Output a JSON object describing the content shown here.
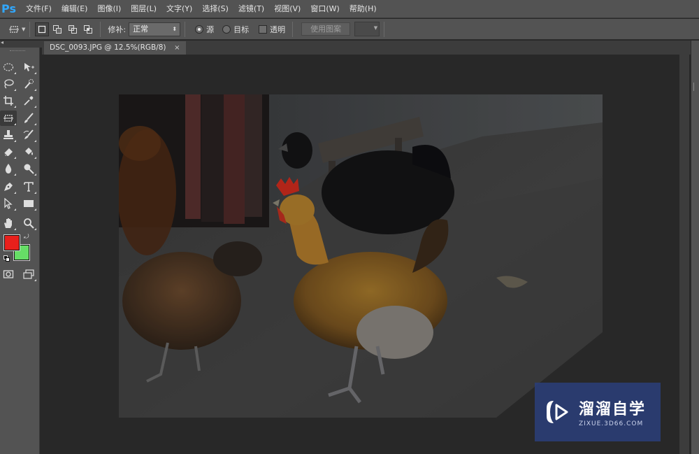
{
  "app": {
    "logo": "Ps"
  },
  "menu": [
    "文件(F)",
    "编辑(E)",
    "图像(I)",
    "图层(L)",
    "文字(Y)",
    "选择(S)",
    "滤镜(T)",
    "视图(V)",
    "窗口(W)",
    "帮助(H)"
  ],
  "options": {
    "tool_icon": "patch-tool-icon",
    "patch_label": "修补:",
    "patch_value": "正常",
    "source_label": "源",
    "target_label": "目标",
    "transparent_label": "透明",
    "use_pattern_label": "使用图案",
    "source_selected": true,
    "target_selected": false,
    "transparent_checked": false
  },
  "document": {
    "tab_title": "DSC_0093.JPG @ 12.5%(RGB/8)",
    "close_glyph": "×"
  },
  "colors": {
    "foreground": "#e8201c",
    "background": "#66dd66",
    "accent": "#31a8ff"
  },
  "tools": [
    "marquee-icon",
    "move-icon",
    "lasso-icon",
    "quick-selection-icon",
    "crop-icon",
    "eyedropper-icon",
    "patch-tool-icon",
    "brush-icon",
    "stamp-icon",
    "history-brush-icon",
    "eraser-icon",
    "paint-bucket-icon",
    "blur-icon",
    "dodge-icon",
    "pen-icon",
    "type-icon",
    "path-selection-icon",
    "rectangle-icon",
    "hand-icon",
    "zoom-icon",
    "quick-mask-icon",
    "screen-mode-icon"
  ],
  "watermark": {
    "title": "溜溜自学",
    "url": "ZIXUE.3D66.COM"
  }
}
